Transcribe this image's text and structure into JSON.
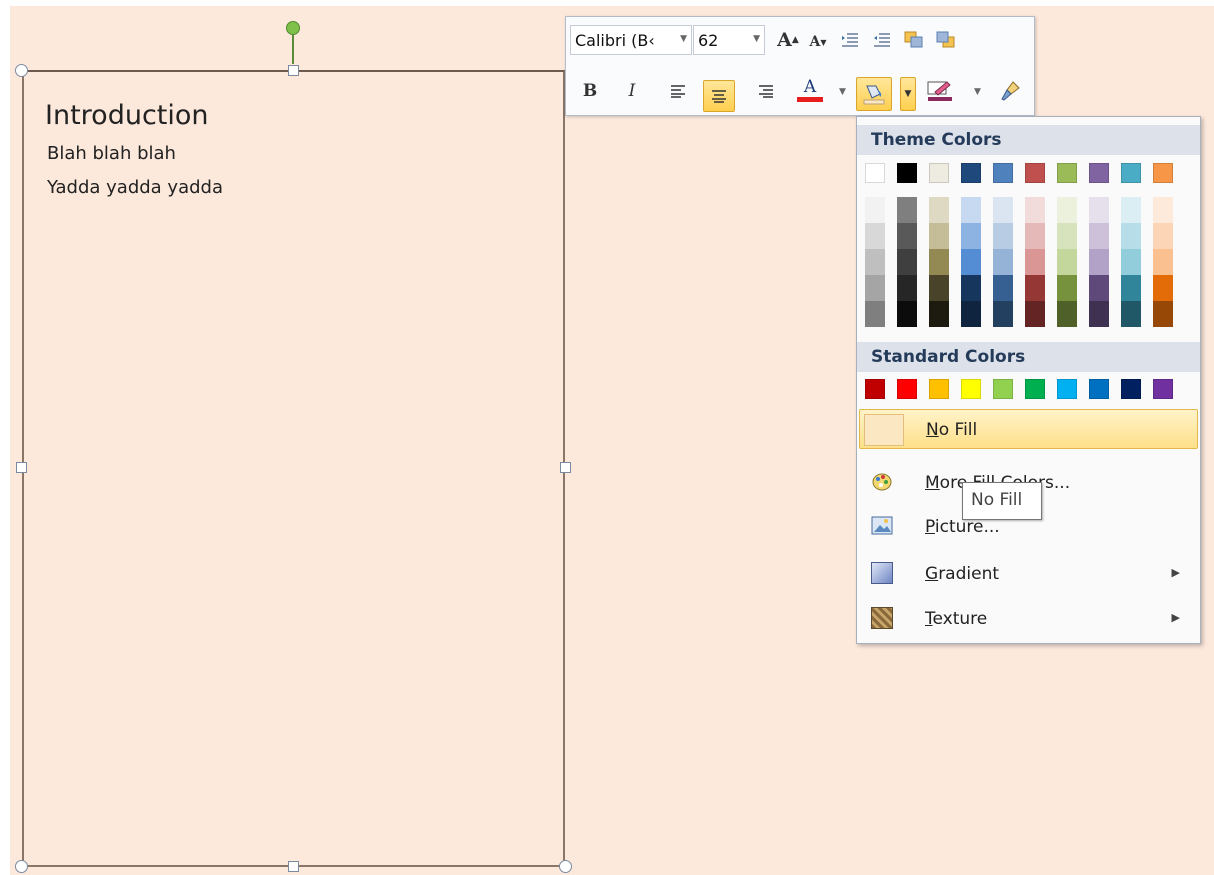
{
  "slide": {
    "background": "#fde9dc",
    "textbox": {
      "title": "Introduction",
      "lines": [
        "Blah blah blah",
        "Yadda yadda yadda"
      ]
    }
  },
  "mini_toolbar": {
    "font_name": "Calibri (B‹",
    "font_size": "62",
    "grow_font_icon": "grow-font-icon",
    "shrink_font_icon": "shrink-font-icon",
    "bold_label": "B",
    "italic_label": "I",
    "font_color_label": "A",
    "font_color": "#e81d1d",
    "align_center_active": true
  },
  "fill_menu": {
    "theme_header": "Theme Colors",
    "standard_header": "Standard Colors",
    "theme_top_row": [
      "#ffffff",
      "#000000",
      "#eeece1",
      "#1f497d",
      "#4f81bd",
      "#c0504d",
      "#9bbb59",
      "#8064a2",
      "#4bacc6",
      "#f79646"
    ],
    "theme_shades": [
      [
        "#f2f2f2",
        "#d8d8d8",
        "#bfbfbf",
        "#a5a5a5",
        "#7f7f7f"
      ],
      [
        "#7f7f7f",
        "#595959",
        "#3f3f3f",
        "#262626",
        "#0c0c0c"
      ],
      [
        "#ddd9c3",
        "#c4bd97",
        "#938953",
        "#494429",
        "#1d1b10"
      ],
      [
        "#c6d9f0",
        "#8db3e2",
        "#548dd4",
        "#17365d",
        "#0f243e"
      ],
      [
        "#dbe5f1",
        "#b8cce4",
        "#95b3d7",
        "#366092",
        "#244061"
      ],
      [
        "#f2dcdb",
        "#e5b9b7",
        "#d99694",
        "#953734",
        "#632423"
      ],
      [
        "#ebf1dd",
        "#d7e3bc",
        "#c3d69b",
        "#76923c",
        "#4f6128"
      ],
      [
        "#e5e0ec",
        "#ccc1d9",
        "#b2a2c7",
        "#5f497a",
        "#3f3151"
      ],
      [
        "#dbeef3",
        "#b7dde8",
        "#92cddc",
        "#31859b",
        "#205867"
      ],
      [
        "#fdeada",
        "#fbd5b5",
        "#fac08f",
        "#e36c09",
        "#974806"
      ]
    ],
    "standard_colors": [
      "#c00000",
      "#ff0000",
      "#ffc000",
      "#ffff00",
      "#92d050",
      "#00b050",
      "#00b0f0",
      "#0070c0",
      "#002060",
      "#7030a0"
    ],
    "items": {
      "no_fill": {
        "accel": "N",
        "rest": "o Fill"
      },
      "more_fill": {
        "accel": "M",
        "rest": "ore Fill Colors..."
      },
      "picture": {
        "accel": "P",
        "rest": "icture..."
      },
      "gradient": {
        "accel": "G",
        "rest": "radient"
      },
      "texture": {
        "accel": "T",
        "rest": "exture"
      }
    }
  },
  "tooltip": {
    "text": "No Fill"
  }
}
